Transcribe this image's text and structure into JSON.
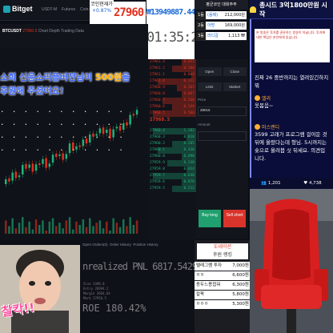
{
  "header": {
    "brand": "Bitget",
    "nav": [
      "USDT-M",
      "Futures",
      "Coin-M Futures"
    ],
    "coin_label": "코인현재가",
    "coin_change": "+0.87%",
    "big_price": "27960.5",
    "krw_price": "₩13949887.44",
    "clock": "01:35:21"
  },
  "symbol_bar": {
    "symbol": "BTCUSDT",
    "price": "27960.5",
    "tabs": [
      "Chart",
      "Depth",
      "Trading Data"
    ]
  },
  "donation": {
    "pre": "소희 신음소리플버전",
    "mid": "님이 ",
    "amount": "500원",
    "post": "을 후원해 주셨어요!"
  },
  "dots_overlay": ". . . . . . . . . . .\n. . . . . . . . . . .\n. . . . . . . . . . .\n. . . . . . . . . . .",
  "orderbook": {
    "asks": [
      {
        "price": "27961.4",
        "qty": "0.051",
        "fill": 0.3
      },
      {
        "price": "27961.2",
        "qty": "0.180",
        "fill": 0.5
      },
      {
        "price": "27961.1",
        "qty": "0.004",
        "fill": 0.1
      },
      {
        "price": "27961.0",
        "qty": "0.322",
        "fill": 0.8
      },
      {
        "price": "27960.9",
        "qty": "0.105",
        "fill": 0.4
      },
      {
        "price": "27960.8",
        "qty": "0.067",
        "fill": 0.3
      },
      {
        "price": "27960.7",
        "qty": "0.260",
        "fill": 0.7
      },
      {
        "price": "27960.6",
        "qty": "0.149",
        "fill": 0.5
      },
      {
        "price": "27960.5",
        "qty": "0.508",
        "fill": 0.9
      }
    ],
    "mid": "27960.5",
    "bids": [
      {
        "price": "27960.4",
        "qty": "1.202",
        "fill": 0.9
      },
      {
        "price": "27960.3",
        "qty": "0.018",
        "fill": 0.2
      },
      {
        "price": "27960.2",
        "qty": "0.205",
        "fill": 0.5
      },
      {
        "price": "27960.1",
        "qty": "0.430",
        "fill": 0.8
      },
      {
        "price": "27960.0",
        "qty": "0.090",
        "fill": 0.3
      },
      {
        "price": "27959.9",
        "qty": "0.330",
        "fill": 0.6
      },
      {
        "price": "27959.8",
        "qty": "0.014",
        "fill": 0.2
      },
      {
        "price": "27959.7",
        "qty": "0.640",
        "fill": 0.9
      },
      {
        "price": "27959.6",
        "qty": "0.076",
        "fill": 0.3
      },
      {
        "price": "27959.5",
        "qty": "0.212",
        "fill": 0.5
      }
    ]
  },
  "trade": {
    "tabs": [
      "Open",
      "Close"
    ],
    "order_types": [
      "Limit",
      "Market"
    ],
    "price_label": "Price",
    "price_value": "28015",
    "amount_label": "Amount",
    "buy_label": "Buy long",
    "sell_label": "Sell short"
  },
  "ranking": {
    "title": "평균코인 대회주주",
    "rows": [
      {
        "rank": "1등",
        "name": "(음제)",
        "value": "212,000원"
      },
      {
        "rank": "2등",
        "name": "아방",
        "value": "169,000원"
      },
      {
        "rank": "3등",
        "name": "라디갈",
        "value": "1,113 ₩"
      }
    ]
  },
  "positions": {
    "tabs": [
      "Open Orders(0)",
      "Order History",
      "Position History"
    ],
    "pnl": "nrealized PNL 6817.54299",
    "roe": "ROE 180.42%",
    "lines": [
      "Size 2498.8",
      "Entry 26994.2",
      "Margin 2664.64",
      "Mark 27950.5"
    ]
  },
  "leaders": {
    "wallet": "도네이션",
    "wallet_sub": "후원 랭킹",
    "rows": [
      {
        "name": "텔레그램 투자",
        "value": "7,000원"
      },
      {
        "name": "ㅇㅇ",
        "value": "6,600원"
      },
      {
        "name": "동두느용접워",
        "value": "6,300원"
      },
      {
        "name": "칼팍",
        "value": "5,800원"
      },
      {
        "name": "ㅇㅇㅇ",
        "value": "5,300원"
      }
    ]
  },
  "cam": {
    "caption": "찰칵!!"
  },
  "chat": {
    "header": "총시드 3억1800만원 시작",
    "notice": "본 방송은 투자를 권유하는 방송이 아닙니다. 투자에 대한 책임은 본인에게 있습니다.",
    "messages": [
      {
        "user": "",
        "text": "진짜 26 중반까지는 열려있긴하지 뭐"
      },
      {
        "user": "엘리",
        "text": "옷봄음~"
      },
      {
        "user": "미스랜디",
        "text": "3599 고래가 프로그램 걸어둔 것 뒤에 올랐다는데 형님. 5시까지는 숏으로 올려봅 싯 뒤세요. 의견입니다."
      }
    ],
    "viewers": "1,201",
    "likes": "4,738"
  }
}
